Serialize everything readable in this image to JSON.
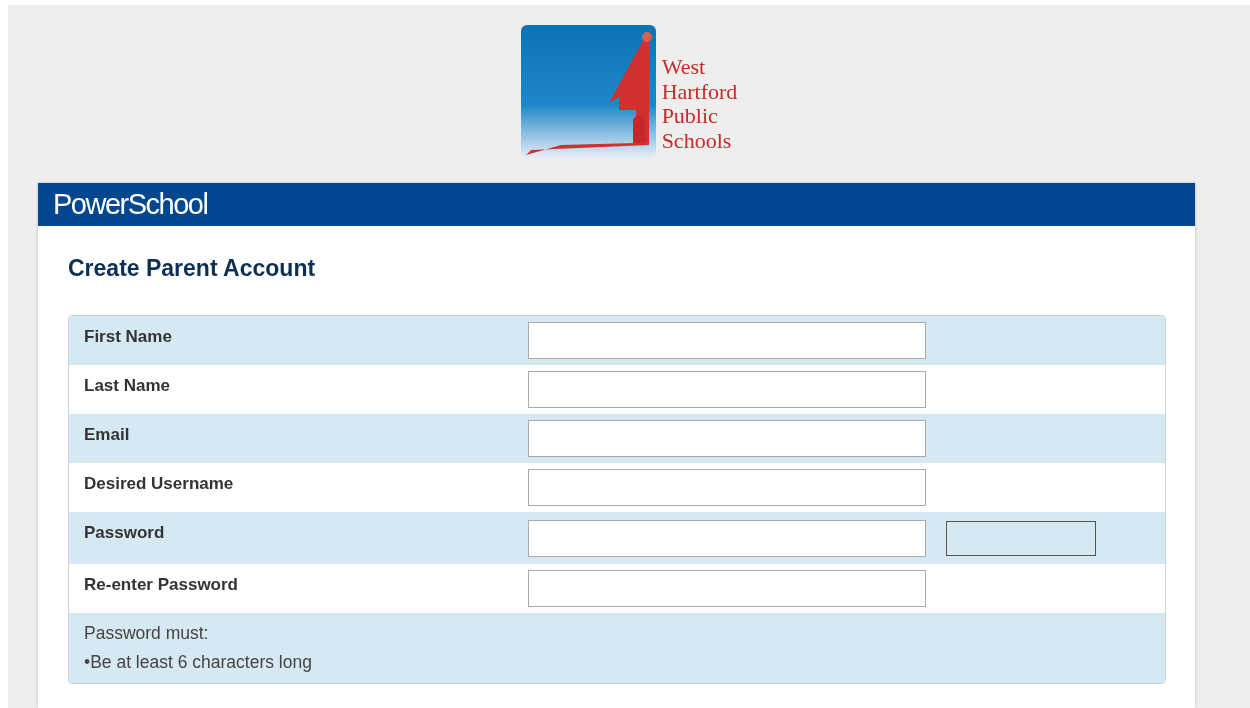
{
  "logo": {
    "lines": [
      "West",
      "Hartford",
      "Public",
      "Schools"
    ]
  },
  "header": {
    "brand": "PowerSchool"
  },
  "form": {
    "title": "Create Parent Account",
    "fields": [
      {
        "label": "First Name",
        "kind": "text"
      },
      {
        "label": "Last Name",
        "kind": "text"
      },
      {
        "label": "Email",
        "kind": "text"
      },
      {
        "label": "Desired Username",
        "kind": "text"
      },
      {
        "label": "Password",
        "kind": "password_with_meter"
      },
      {
        "label": "Re-enter Password",
        "kind": "text"
      }
    ],
    "rules": {
      "heading": "Password must:",
      "items": [
        "•Be at least 6 characters long"
      ]
    }
  }
}
